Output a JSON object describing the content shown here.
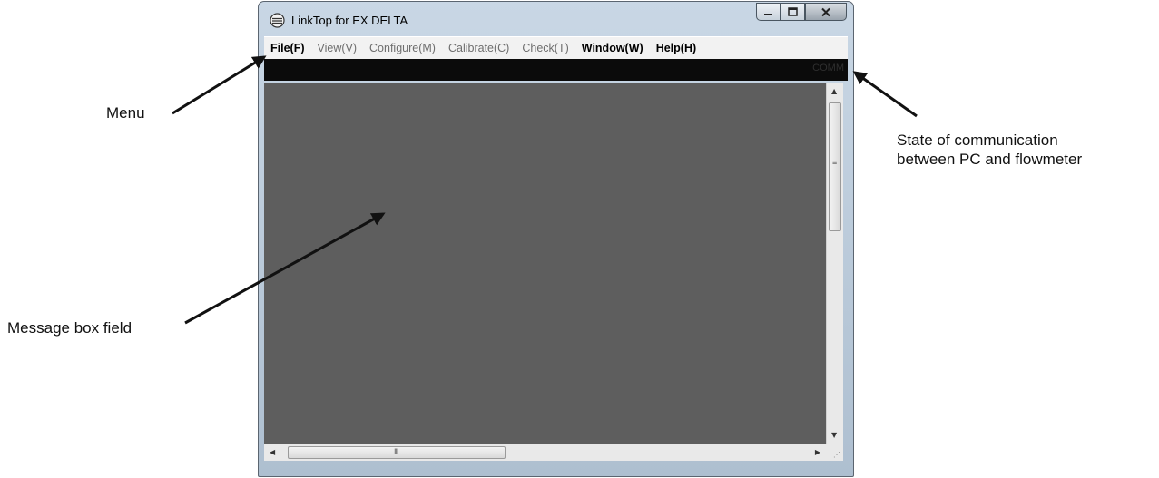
{
  "window": {
    "title": "LinkTop for EX DELTA",
    "menu": [
      {
        "label": "File(F)",
        "enabled": true
      },
      {
        "label": "View(V)",
        "enabled": false
      },
      {
        "label": "Configure(M)",
        "enabled": false
      },
      {
        "label": "Calibrate(C)",
        "enabled": false
      },
      {
        "label": "Check(T)",
        "enabled": false
      },
      {
        "label": "Window(W)",
        "enabled": true
      },
      {
        "label": "Help(H)",
        "enabled": true
      }
    ],
    "comm_state": "COMM"
  },
  "annotations": {
    "menu": "Menu",
    "message_box": "Message box field",
    "state_line1": "State of communication",
    "state_line2": "between PC and flowmeter"
  },
  "colors": {
    "client_area": "#5e5e5e",
    "status_strip": "#0b0b0b",
    "menubar": "#f2f2f2"
  },
  "icons": [
    "app-icon",
    "minimize-icon",
    "maximize-icon",
    "close-icon",
    "scroll-up-icon",
    "scroll-down-icon",
    "scroll-left-icon",
    "scroll-right-icon",
    "size-grip-icon"
  ]
}
